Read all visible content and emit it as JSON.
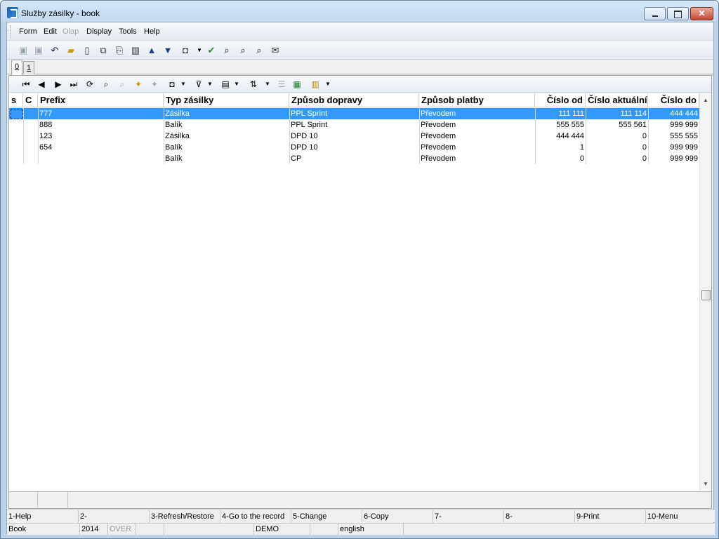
{
  "window": {
    "title": "Služby zásilky - book"
  },
  "menu": [
    "Form",
    "Edit",
    "Olap",
    "Display",
    "Tools",
    "Help"
  ],
  "tabs": [
    "0",
    "1"
  ],
  "columns": [
    "s",
    "C",
    "Prefix",
    "Typ zásilky",
    "Způsob dopravy",
    "Způsob platby",
    "Číslo od",
    "Číslo aktuální",
    "Číslo do"
  ],
  "rows": [
    {
      "prefix": "777",
      "typ": "Zásilka",
      "doprava": "PPL Sprint",
      "platba": "Převodem",
      "od": "111 111",
      "aktualni": "111 114",
      "do": "444 444",
      "selected": true
    },
    {
      "prefix": "888",
      "typ": "Balík",
      "doprava": "PPL Sprint",
      "platba": "Převodem",
      "od": "555 555",
      "aktualni": "555 561",
      "do": "999 999",
      "selected": false
    },
    {
      "prefix": "123",
      "typ": "Zásilka",
      "doprava": "DPD 10",
      "platba": "Převodem",
      "od": "444 444",
      "aktualni": "0",
      "do": "555 555",
      "selected": false
    },
    {
      "prefix": "654",
      "typ": "Balík",
      "doprava": "DPD 10",
      "platba": "Převodem",
      "od": "1",
      "aktualni": "0",
      "do": "999 999",
      "selected": false
    },
    {
      "prefix": "",
      "typ": "Balík",
      "doprava": "CP",
      "platba": "Převodem",
      "od": "0",
      "aktualni": "0",
      "do": "999 999",
      "selected": false
    }
  ],
  "function_keys": [
    "1-Help",
    "2-",
    "3-Refresh/Restore",
    "4-Go to the record",
    "5-Change",
    "6-Copy",
    "7-",
    "8-",
    "9-Print",
    "10-Menu"
  ],
  "status": {
    "book": "Book",
    "year": "2014",
    "mode": "OVER",
    "db": "DEMO",
    "language": "english"
  }
}
